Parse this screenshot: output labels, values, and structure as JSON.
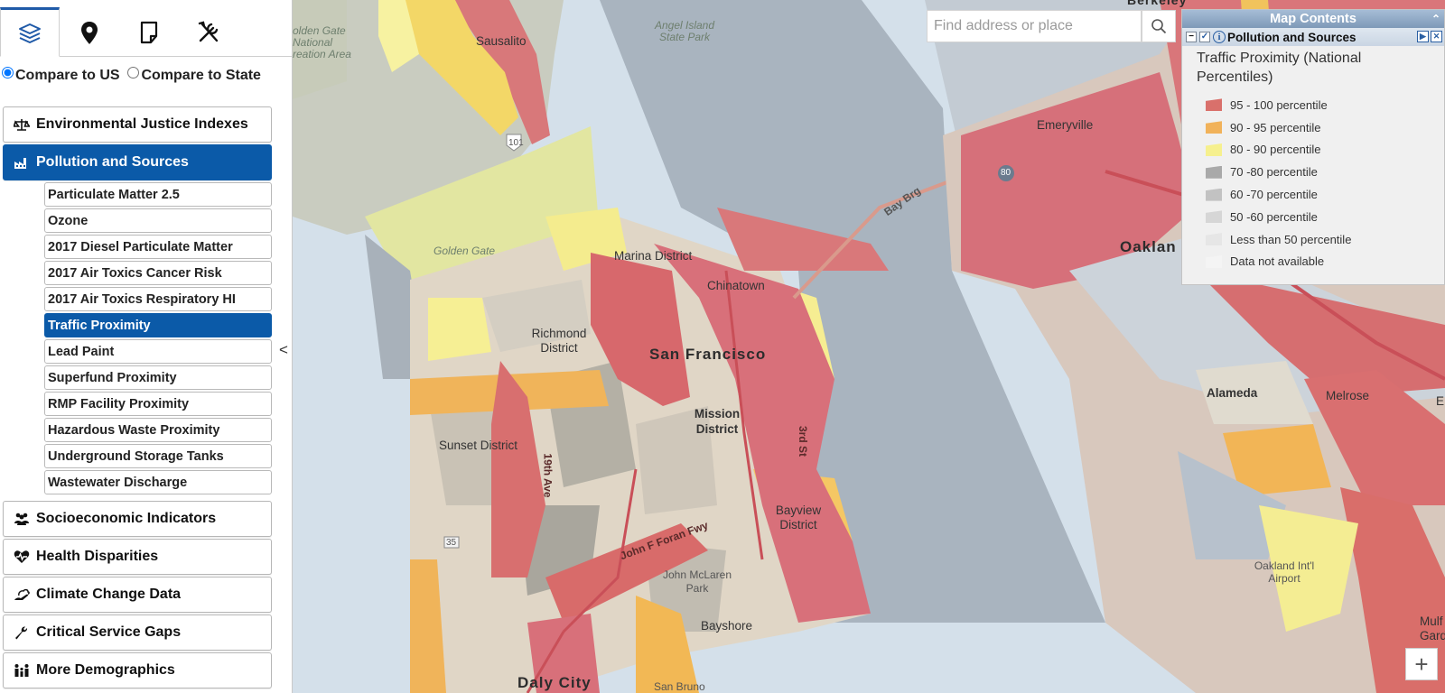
{
  "tool_tabs": [
    {
      "icon": "layers-icon",
      "active": true
    },
    {
      "icon": "map-pin-icon",
      "active": false
    },
    {
      "icon": "note-icon",
      "active": false
    },
    {
      "icon": "tools-icon",
      "active": false
    }
  ],
  "compare": {
    "us_label": "Compare to US",
    "state_label": "Compare to State",
    "selected": "us"
  },
  "categories": [
    {
      "label": "Environmental Justice Indexes",
      "icon": "scales-icon",
      "active": false
    },
    {
      "label": "Pollution and Sources",
      "icon": "factory-icon",
      "active": true
    },
    {
      "label": "Socioeconomic Indicators",
      "icon": "people-icon",
      "active": false
    },
    {
      "label": "Health Disparities",
      "icon": "heartbeat-icon",
      "active": false
    },
    {
      "label": "Climate Change Data",
      "icon": "climate-icon",
      "active": false
    },
    {
      "label": "Critical Service Gaps",
      "icon": "wrench-icon",
      "active": false
    },
    {
      "label": "More Demographics",
      "icon": "family-icon",
      "active": false
    }
  ],
  "pollution_items": [
    "Particulate Matter 2.5",
    "Ozone",
    "2017 Diesel Particulate Matter",
    "2017 Air Toxics Cancer Risk",
    "2017 Air Toxics Respiratory HI",
    "Traffic Proximity",
    "Lead Paint",
    "Superfund Proximity",
    "RMP Facility Proximity",
    "Hazardous Waste Proximity",
    "Underground Storage Tanks",
    "Wastewater Discharge"
  ],
  "active_pollution_item": "Traffic Proximity",
  "collapse_glyph": "<",
  "search": {
    "placeholder": "Find address or place"
  },
  "map_contents": {
    "title": "Map Contents",
    "layer_name": "Pollution and Sources",
    "legend_title": "Traffic Proximity (National Percentiles)",
    "legend": [
      {
        "label": "95 - 100 percentile",
        "color": "#d9706b"
      },
      {
        "label": "90 - 95 percentile",
        "color": "#f1b25a"
      },
      {
        "label": "80 - 90 percentile",
        "color": "#f6f08e"
      },
      {
        "label": "70 -80 percentile",
        "color": "#a9a9a9"
      },
      {
        "label": "60 -70 percentile",
        "color": "#c2c2c2"
      },
      {
        "label": "50 -60 percentile",
        "color": "#d6d6d6"
      },
      {
        "label": "Less than 50 percentile",
        "color": "#e6e6e6"
      },
      {
        "label": "Data not available",
        "color": "#f4f4f4"
      }
    ]
  },
  "map_labels": {
    "san_francisco": "San Francisco",
    "oakland": "Oaklan",
    "daly_city": "Daly City",
    "sausalito": "Sausalito",
    "emeryville": "Emeryville",
    "berkeley": "Berkeley",
    "alameda": "Alameda",
    "melrose": "Melrose",
    "marina": "Marina District",
    "chinatown": "Chinatown",
    "richmond": "Richmond District",
    "mission": "Mission District",
    "sunset": "Sunset District",
    "bayview": "Bayview District",
    "bayshore": "Bayshore",
    "john_mclaren": "John McLaren Park",
    "golden_gate": "Golden Gate",
    "golden_gate_nra": "olden Gate National reation Area",
    "angel_island": "Angel Island State Park",
    "oakland_airport": "Oakland Int'l Airport",
    "san_bruno": "San Bruno",
    "bay_brg": "Bay Brg",
    "john_foran": "John F Foran Fwy",
    "hwy_101": "101",
    "hwy_80": "80",
    "hwy_35": "35",
    "ave_19": "19th Ave",
    "third_st": "3rd St",
    "e_edge": "E",
    "mulf": "Mulf",
    "gard": "Gard"
  },
  "zoom_in_label": "+"
}
